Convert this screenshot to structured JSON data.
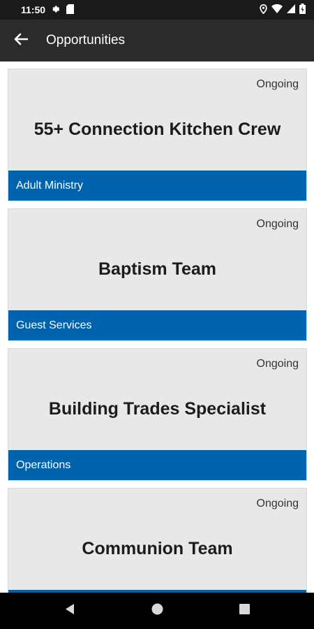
{
  "status_bar": {
    "time": "11:50",
    "icons": [
      "settings-icon",
      "sd-card-icon",
      "location-icon",
      "wifi-icon",
      "signal-icon",
      "battery-icon"
    ]
  },
  "app_bar": {
    "title": "Opportunities",
    "back_icon": "arrow-back-icon"
  },
  "colors": {
    "accent": "#0063ad",
    "app_bar": "#2b2b2b",
    "card_bg": "#e8e8e8"
  },
  "opportunities": [
    {
      "status": "Ongoing",
      "title": "55+ Connection Kitchen Crew",
      "category": "Adult Ministry"
    },
    {
      "status": "Ongoing",
      "title": "Baptism Team",
      "category": "Guest Services"
    },
    {
      "status": "Ongoing",
      "title": "Building Trades Specialist",
      "category": "Operations"
    },
    {
      "status": "Ongoing",
      "title": "Communion Team",
      "category": ""
    }
  ],
  "nav_bar": {
    "icons": [
      "back-triangle-icon",
      "home-circle-icon",
      "recents-square-icon"
    ]
  }
}
